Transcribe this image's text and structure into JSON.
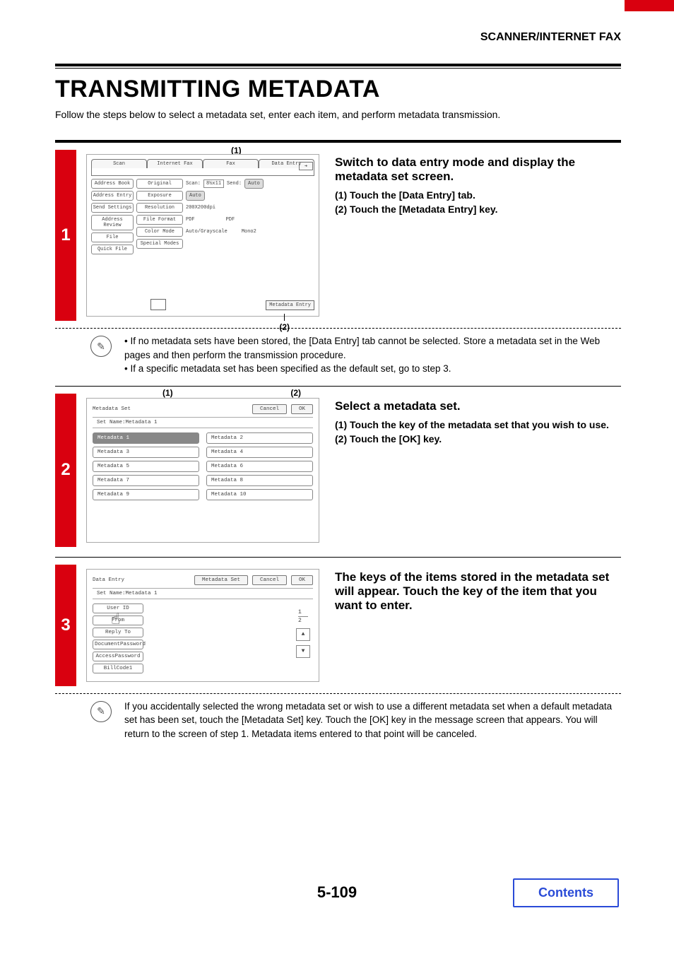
{
  "header": {
    "section": "SCANNER/INTERNET FAX"
  },
  "title": "TRANSMITTING METADATA",
  "lead": "Follow the steps below to select a metadata set, enter each item, and perform metadata transmission.",
  "step1": {
    "num": "1",
    "anno1": "(1)",
    "anno2": "(2)",
    "ui": {
      "tabs": [
        "Scan",
        "Internet Fax",
        "Fax",
        "Data Entry"
      ],
      "left": [
        "Address Book",
        "Address Entry",
        "Send Settings",
        "Address Review",
        "File",
        "Quick File"
      ],
      "rows": {
        "original": {
          "label": "Original",
          "scan": "Scan:",
          "size": "8½x11",
          "send": "Send:",
          "auto": "Auto"
        },
        "exposure": {
          "label": "Exposure",
          "val": "Auto"
        },
        "resolution": {
          "label": "Resolution",
          "val": "200X200dpi"
        },
        "fileformat": {
          "label": "File Format",
          "v1": "PDF",
          "v2": "PDF"
        },
        "colormode": {
          "label": "Color Mode",
          "v1": "Auto/Grayscale",
          "v2": "Mono2"
        },
        "special": {
          "label": "Special Modes"
        }
      },
      "meta_entry": "Metadata Entry"
    },
    "instr": {
      "title": "Switch to data entry mode and display the metadata set screen.",
      "i1": "(1)  Touch the [Data Entry] tab.",
      "i2": "(2)  Touch the [Metadata Entry] key."
    },
    "note1": "If no metadata sets have been stored, the [Data Entry] tab cannot be selected. Store a metadata set in the Web pages and then perform the transmission procedure.",
    "note2": "If a specific metadata set has been specified as the default set, go to step 3."
  },
  "step2": {
    "num": "2",
    "anno1": "(1)",
    "anno2": "(2)",
    "ui": {
      "title": "Metadata Set",
      "cancel": "Cancel",
      "ok": "OK",
      "setname": "Set Name:Metadata 1",
      "cells": [
        "Metadata 1",
        "Metadata 2",
        "Metadata 3",
        "Metadata 4",
        "Metadata 5",
        "Metadata 6",
        "Metadata 7",
        "Metadata 8",
        "Metadata 9",
        "Metadata 10"
      ]
    },
    "instr": {
      "title": "Select a metadata set.",
      "i1": "(1)  Touch the key of the metadata set that you wish to use.",
      "i2": "(2)  Touch the [OK] key."
    }
  },
  "step3": {
    "num": "3",
    "ui": {
      "title": "Data Entry",
      "meta": "Metadata Set",
      "cancel": "Cancel",
      "ok": "OK",
      "setname": "Set Name:Metadata 1",
      "items": [
        "User ID",
        "From",
        "Reply To",
        "DocumentPassword",
        "AccessPassword",
        "BillCode1"
      ],
      "page_cur": "1",
      "page_tot": "2"
    },
    "instr": {
      "title": "The keys of the items stored in the metadata set will appear. Touch the key of the item that you want to enter."
    },
    "note": "If you accidentally selected the wrong metadata set or wish to use a different metadata set when a default metadata set has been set, touch the [Metadata Set] key. Touch the [OK] key in the message screen that appears. You will return to the screen of step 1. Metadata items entered to that point will be canceled."
  },
  "footer": {
    "pagenum": "5-109",
    "contents": "Contents"
  }
}
